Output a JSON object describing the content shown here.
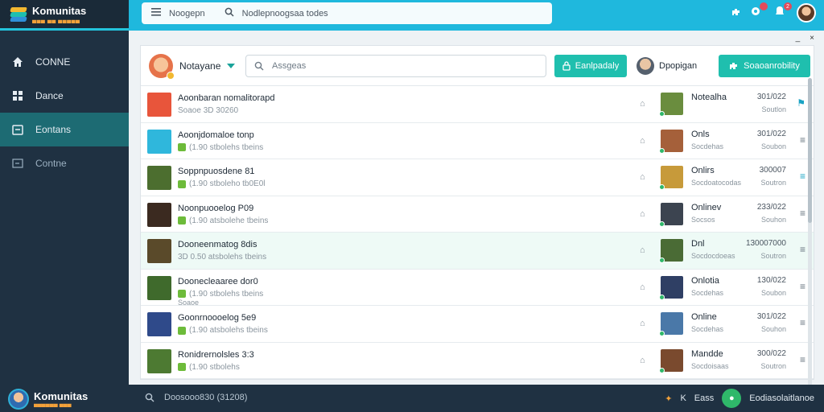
{
  "app": {
    "logo_title": "Komunitas",
    "logo_sub": "▄▄▄ ▄▄ ▄▄▄▄▄"
  },
  "sidebar": {
    "items": [
      {
        "label": "CONNE",
        "icon": "home-icon"
      },
      {
        "label": "Dance",
        "icon": "puzzle-icon"
      },
      {
        "label": "Eontans",
        "icon": "folder-icon"
      },
      {
        "label": "Contne",
        "icon": "logout-icon"
      }
    ]
  },
  "topbar": {
    "menu_label": "Noogepn",
    "search_placeholder": "Nodlepnoogsaa todes",
    "notification_count": "2"
  },
  "window": {
    "minimize": "_",
    "close": "×"
  },
  "card": {
    "user_name": "Notayane",
    "search_placeholder": "Assgeas",
    "button_primary": "Eanlpadaly",
    "mid_user": "Dpopigan",
    "button_secondary": "Soaoanrobility"
  },
  "rows": [
    {
      "title": "Aoonbaran nomalitorapd",
      "meta": "Soaoe 3D 30260",
      "meta2": "",
      "status": "Notealha",
      "sub": "",
      "date": "301/022",
      "date2": "Soutlon",
      "thumb": "#e8553b",
      "pic": "#6a8d3e",
      "chip": false,
      "act": "⚑",
      "hl": false
    },
    {
      "title": "Aoonjdomaloe tonp",
      "meta": "(1.90 stbolehs tbeins",
      "meta2": "",
      "status": "Onls",
      "sub": "Socdehas",
      "date": "301/022",
      "date2": "Soubon",
      "thumb": "#2fb7dc",
      "pic": "#a5603a",
      "chip": true,
      "act": "≡",
      "hl": false
    },
    {
      "title": "Soppnpuosdene 81",
      "meta": "(1.90 stboleho tb0E0l",
      "meta2": "",
      "status": "Onlirs",
      "sub": "Socdoatocodas",
      "date": "300007",
      "date2": "Soutron",
      "thumb": "#4c6e2f",
      "pic": "#c79a3a",
      "chip": true,
      "act": "≡",
      "hl": false
    },
    {
      "title": "Noonpuooelog P09",
      "meta": "(1.90 atsbolehe tbeins",
      "meta2": "",
      "status": "Onlinev",
      "sub": "Socsos",
      "date": "233/022",
      "date2": "Souhon",
      "thumb": "#3b2a20",
      "pic": "#3c4450",
      "chip": true,
      "act": "≡",
      "hl": false
    },
    {
      "title": "Dooneenmatog 8dis",
      "meta": "3D 0.50 atsbolehs tbeins",
      "meta2": "",
      "status": "Dnl",
      "sub": "Socdocdoeas",
      "date": "130007000",
      "date2": "Soutron",
      "thumb": "#5a4a2a",
      "pic": "#4a6b35",
      "chip": false,
      "act": "≡",
      "hl": true
    },
    {
      "title": "Doonecleaaree dor0",
      "meta": "(1.90 stbolehs tbeins",
      "meta2": "Soaoe",
      "status": "Onlotia",
      "sub": "Socdehas",
      "date": "130/022",
      "date2": "Soubon",
      "thumb": "#3f6a2c",
      "pic": "#2f3f64",
      "chip": true,
      "act": "≡",
      "hl": false
    },
    {
      "title": "Goonrnoooelog 5e9",
      "meta": "(1.90 atsbolehs tbeins",
      "meta2": "",
      "status": "Online",
      "sub": "Socdehas",
      "date": "301/022",
      "date2": "Souhon",
      "thumb": "#2f4a8a",
      "pic": "#4a78a8",
      "chip": true,
      "act": "≡",
      "hl": false
    },
    {
      "title": "Ronidrernolsles 3:3",
      "meta": "(1.90 stbolehs",
      "meta2": "",
      "status": "Mandde",
      "sub": "Socdoisaas",
      "date": "300/022",
      "date2": "Soutron",
      "thumb": "#4d7a32",
      "pic": "#7a4a2e",
      "chip": true,
      "act": "≡",
      "hl": false
    }
  ],
  "bottombar": {
    "brand": "Komunitas",
    "brand_sub": "▄▄▄▄▄▄ ▄▄▄",
    "search_text": "Doosooo830 (31208)",
    "right_k": "K",
    "right_label": "Eass",
    "right_status": "Eodiasolaitlanoe"
  },
  "colors": {
    "accent": "#1fb8dd",
    "teal": "#1fbfae",
    "sidebar": "#1f3142"
  }
}
